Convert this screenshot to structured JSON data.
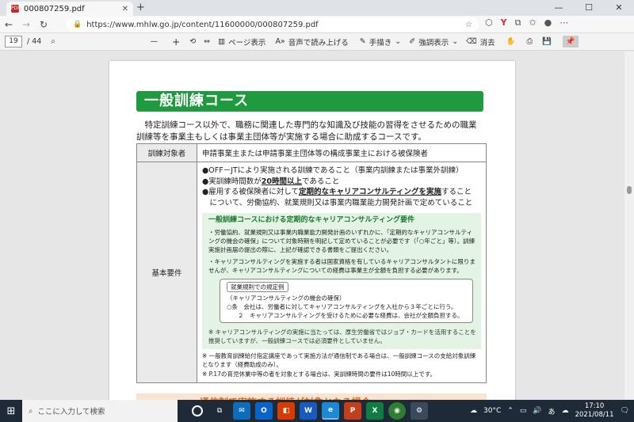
{
  "browser": {
    "tab_title": "000807259.pdf",
    "tab_close": "✕",
    "new_tab": "+",
    "url": "https://www.mhlw.go.jp/content/11600000/000807259.pdf",
    "window_controls": [
      "—",
      "☐",
      "✕"
    ]
  },
  "pdf_toolbar": {
    "page_current": "19",
    "page_total": "/ 44",
    "zoom_out": "—",
    "zoom_in": "+",
    "page_view_label": "ページ表示",
    "read_aloud_label": "音声で読み上げる",
    "draw_label": "手描き",
    "highlight_label": "強調表示",
    "erase_label": "消去"
  },
  "document": {
    "banner_title": "一般訓練コース",
    "intro": "特定訓練コース以外で、職務に関連した専門的な知識及び技能の習得をさせるための職業訓練等を事業主もしくは事業主団体等が実施する場合に助成するコースです。",
    "row1": {
      "header": "訓練対象者",
      "content": "申請事業主または申請事業主団体等の構成事業主における被保険者"
    },
    "row2": {
      "header": "基本要件",
      "req1": "●OFF－JTにより実施される訓練であること（事業内訓練または事業外訓練）",
      "req2_a": "●実訓練時間数が",
      "req2_b": "20時間以上",
      "req2_c": "であること",
      "req3_a": "●雇用する被保険者に対して",
      "req3_b": "定期的なキャリアコンサルティングを実施",
      "req3_c": "すること",
      "req3_d": "　について、労働協約、就業規則又は事業内職業能力開発計画で定めていること",
      "green_title": "一般訓練コースにおける定期的なキャリアコンサルティング要件",
      "green_p1": "・労働協約、就業規則又は事業内職業能力開発計画のいずれかに、「定期的なキャリアコンサルティングの機会の確保」について対象時期を明記して定めていることが必要です（「○年ごと」等）。訓練実施計画届の提出の際に、上記が確認できる書類をご提出ください。",
      "green_p2": "・キャリアコンサルティングを実施する者は国家資格を有しているキャリアコンサルタントに限りませんが、キャリアコンサルティングについての経費は事業主が全額を負担する必要があります。",
      "rule_tag": "就業規則での規定例",
      "rule_1": "（キャリアコンサルティングの機会の確保）",
      "rule_2": "○条　会社は、労働者に対してキャリアコンサルティングを入社から３年ごとに行う。",
      "rule_3": "２　キャリアコンサルティングを受けるために必要な経費は、会社が全額負担する。",
      "green_foot": "※ キャリアコンサルティングの実施に当たっては、厚生労働省ではジョブ・カードを活用することを推奨していますが、一般訓練コースでは必須要件としていません。",
      "note1": "※ 一般教育訓練給付指定講座であって実施方法が通信制である場合は、一般訓練コースの支給対象訓練となります（経費助成のみ）。",
      "note2": "※ P.17の育児休業中等の者を対象とする場合は、実訓練時間の要件は10時間以上です。"
    },
    "next_heading": "通信制で実施する訓練が対象となる場合"
  },
  "taskbar": {
    "search_placeholder": "ここに入力して検索",
    "weather": "30°C",
    "time": "17:10",
    "date": "2021/08/11",
    "ime": "あ"
  },
  "colors": {
    "banner": "#1f9a3f",
    "green_box": "#e4f4e4",
    "taskbar": "#1f2a38"
  }
}
